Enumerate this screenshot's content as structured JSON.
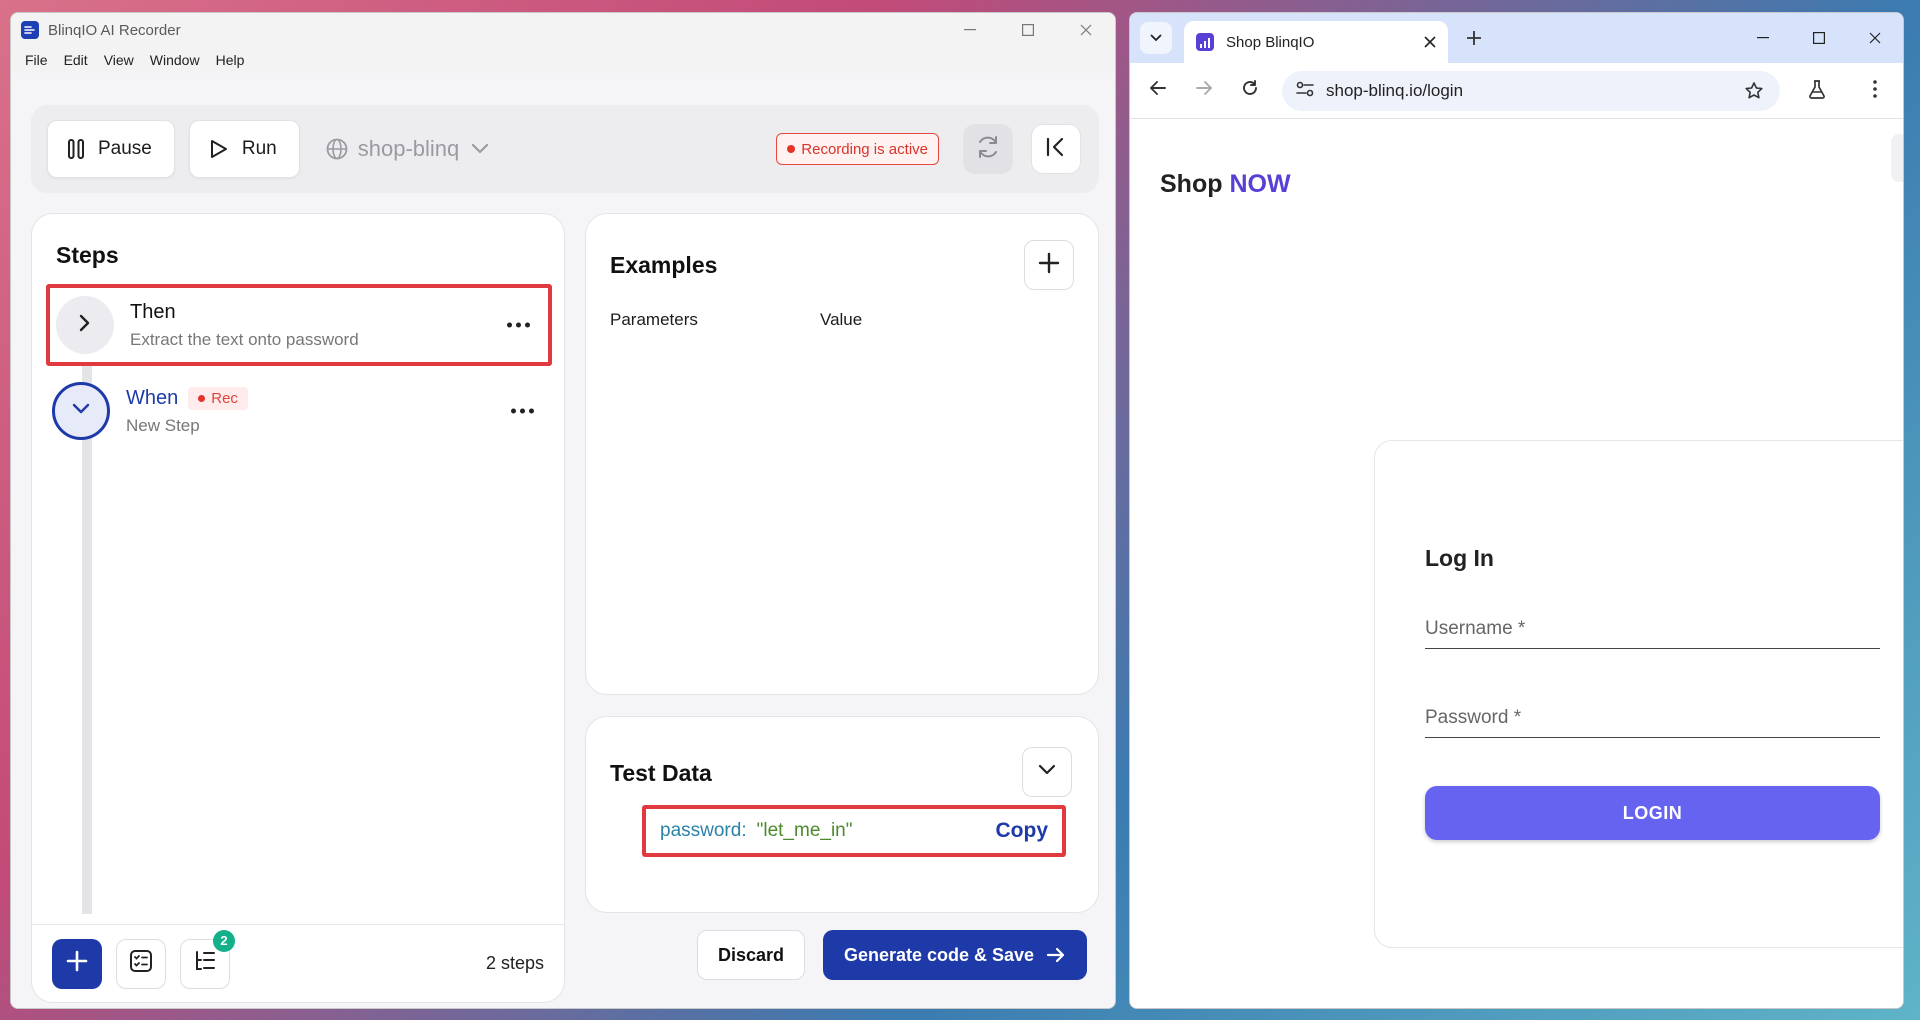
{
  "app": {
    "title": "BlinqIO AI Recorder",
    "menu": [
      "File",
      "Edit",
      "View",
      "Window",
      "Help"
    ],
    "toolbar": {
      "pause_label": "Pause",
      "run_label": "Run",
      "site": "shop-blinq",
      "recording_status": "Recording is active"
    },
    "steps": {
      "title": "Steps",
      "items": [
        {
          "keyword": "Then",
          "description": "Extract the text onto password",
          "expanded": false,
          "highlighted": true
        },
        {
          "keyword": "When",
          "description": "New Step",
          "rec_tag": "Rec",
          "expanded": true
        }
      ],
      "badge_count": "2",
      "count_label": "2 steps"
    },
    "examples": {
      "title": "Examples",
      "columns": [
        "Parameters",
        "Value"
      ]
    },
    "test_data": {
      "title": "Test Data",
      "key": "password:",
      "value": "\"let_me_in\"",
      "copy_label": "Copy"
    },
    "actions": {
      "discard_label": "Discard",
      "generate_label": "Generate code & Save"
    },
    "colors": {
      "primary": "#1e3aa8",
      "recording": "#e0393f",
      "success_badge": "#14b08a"
    }
  },
  "browser": {
    "tab_title": "Shop BlinqIO",
    "url": "shop-blinq.io/login",
    "page": {
      "logo_prefix": "Shop",
      "logo_accent": "NOW",
      "login_title": "Log In",
      "username_label": "Username *",
      "password_label": "Password *",
      "login_button": "LOGIN"
    },
    "colors": {
      "accent": "#5a3fd6",
      "login_button": "#6563ef"
    }
  }
}
